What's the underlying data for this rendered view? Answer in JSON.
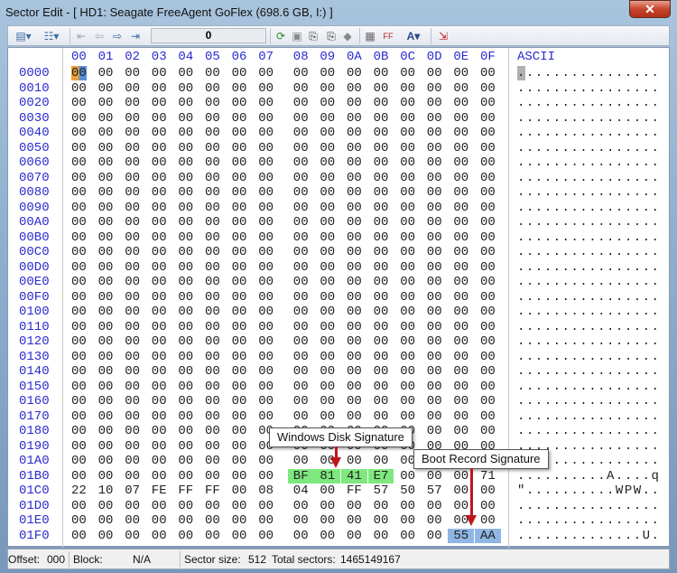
{
  "window": {
    "title": "Sector Edit - [ HD1: Seagate FreeAgent GoFlex (698.6 GB, I:) ]",
    "close_label": "✕"
  },
  "toolbar": {
    "position_value": "0",
    "icons": [
      "view-mode-icon",
      "layout-icon",
      "first-sector-icon",
      "prev-sector-icon",
      "next-sector-icon",
      "last-sector-icon",
      "refresh-icon",
      "save-icon",
      "copy-sector-icon",
      "paste-sector-icon",
      "fill-icon",
      "calculator-icon",
      "hex-convert-icon",
      "font-icon",
      "exit-icon"
    ]
  },
  "header": {
    "columns": [
      "00",
      "01",
      "02",
      "03",
      "04",
      "05",
      "06",
      "07",
      "08",
      "09",
      "0A",
      "0B",
      "0C",
      "0D",
      "0E",
      "0F"
    ],
    "ascii_label": "ASCII"
  },
  "rows": [
    {
      "offset": "0000",
      "bytes": "00 00 00 00 00 00 00 00 00 00 00 00 00 00 00 00",
      "ascii": "................"
    },
    {
      "offset": "0010",
      "bytes": "00 00 00 00 00 00 00 00 00 00 00 00 00 00 00 00",
      "ascii": "................"
    },
    {
      "offset": "0020",
      "bytes": "00 00 00 00 00 00 00 00 00 00 00 00 00 00 00 00",
      "ascii": "................"
    },
    {
      "offset": "0030",
      "bytes": "00 00 00 00 00 00 00 00 00 00 00 00 00 00 00 00",
      "ascii": "................"
    },
    {
      "offset": "0040",
      "bytes": "00 00 00 00 00 00 00 00 00 00 00 00 00 00 00 00",
      "ascii": "................"
    },
    {
      "offset": "0050",
      "bytes": "00 00 00 00 00 00 00 00 00 00 00 00 00 00 00 00",
      "ascii": "................"
    },
    {
      "offset": "0060",
      "bytes": "00 00 00 00 00 00 00 00 00 00 00 00 00 00 00 00",
      "ascii": "................"
    },
    {
      "offset": "0070",
      "bytes": "00 00 00 00 00 00 00 00 00 00 00 00 00 00 00 00",
      "ascii": "................"
    },
    {
      "offset": "0080",
      "bytes": "00 00 00 00 00 00 00 00 00 00 00 00 00 00 00 00",
      "ascii": "................"
    },
    {
      "offset": "0090",
      "bytes": "00 00 00 00 00 00 00 00 00 00 00 00 00 00 00 00",
      "ascii": "................"
    },
    {
      "offset": "00A0",
      "bytes": "00 00 00 00 00 00 00 00 00 00 00 00 00 00 00 00",
      "ascii": "................"
    },
    {
      "offset": "00B0",
      "bytes": "00 00 00 00 00 00 00 00 00 00 00 00 00 00 00 00",
      "ascii": "................"
    },
    {
      "offset": "00C0",
      "bytes": "00 00 00 00 00 00 00 00 00 00 00 00 00 00 00 00",
      "ascii": "................"
    },
    {
      "offset": "00D0",
      "bytes": "00 00 00 00 00 00 00 00 00 00 00 00 00 00 00 00",
      "ascii": "................"
    },
    {
      "offset": "00E0",
      "bytes": "00 00 00 00 00 00 00 00 00 00 00 00 00 00 00 00",
      "ascii": "................"
    },
    {
      "offset": "00F0",
      "bytes": "00 00 00 00 00 00 00 00 00 00 00 00 00 00 00 00",
      "ascii": "................"
    },
    {
      "offset": "0100",
      "bytes": "00 00 00 00 00 00 00 00 00 00 00 00 00 00 00 00",
      "ascii": "................"
    },
    {
      "offset": "0110",
      "bytes": "00 00 00 00 00 00 00 00 00 00 00 00 00 00 00 00",
      "ascii": "................"
    },
    {
      "offset": "0120",
      "bytes": "00 00 00 00 00 00 00 00 00 00 00 00 00 00 00 00",
      "ascii": "................"
    },
    {
      "offset": "0130",
      "bytes": "00 00 00 00 00 00 00 00 00 00 00 00 00 00 00 00",
      "ascii": "................"
    },
    {
      "offset": "0140",
      "bytes": "00 00 00 00 00 00 00 00 00 00 00 00 00 00 00 00",
      "ascii": "................"
    },
    {
      "offset": "0150",
      "bytes": "00 00 00 00 00 00 00 00 00 00 00 00 00 00 00 00",
      "ascii": "................"
    },
    {
      "offset": "0160",
      "bytes": "00 00 00 00 00 00 00 00 00 00 00 00 00 00 00 00",
      "ascii": "................"
    },
    {
      "offset": "0170",
      "bytes": "00 00 00 00 00 00 00 00 00 00 00 00 00 00 00 00",
      "ascii": "................"
    },
    {
      "offset": "0180",
      "bytes": "00 00 00 00 00 00 00 00 00 00 00 00 00 00 00 00",
      "ascii": "................"
    },
    {
      "offset": "0190",
      "bytes": "00 00 00 00 00 00 00 00 00 00 00 00 00 00 00 00",
      "ascii": "................"
    },
    {
      "offset": "01A0",
      "bytes": "00 00 00 00 00 00 00 00 00 00 00 00 00 00 00 00",
      "ascii": "................"
    },
    {
      "offset": "01B0",
      "bytes": "00 00 00 00 00 00 00 00 BF 81 41 E7 00 00 00 71",
      "ascii": "..........A....q"
    },
    {
      "offset": "01C0",
      "bytes": "22 10 07 FE FF FF 00 08 04 00 FF 57 50 57 00 00",
      "ascii": "\"..........WPW.."
    },
    {
      "offset": "01D0",
      "bytes": "00 00 00 00 00 00 00 00 00 00 00 00 00 00 00 00",
      "ascii": "................"
    },
    {
      "offset": "01E0",
      "bytes": "00 00 00 00 00 00 00 00 00 00 00 00 00 00 00 00",
      "ascii": "................"
    },
    {
      "offset": "01F0",
      "bytes": "00 00 00 00 00 00 00 00 00 00 00 00 00 00 55 AA",
      "ascii": "..............U."
    }
  ],
  "highlights": {
    "disk_signature_color": "#7ee87e",
    "boot_signature_color": "#8fb6e4",
    "cursor_color": "#e8a23a"
  },
  "callouts": {
    "disk_signature": "Windows Disk Signature",
    "boot_signature": "Boot Record Signature"
  },
  "status": {
    "offset_label": "Offset:",
    "offset_value": "000",
    "block_label": "Block:",
    "block_value": "N/A",
    "sector_size_label": "Sector size:",
    "sector_size_value": "512",
    "total_label": "Total sectors:",
    "total_value": "1465149167"
  }
}
